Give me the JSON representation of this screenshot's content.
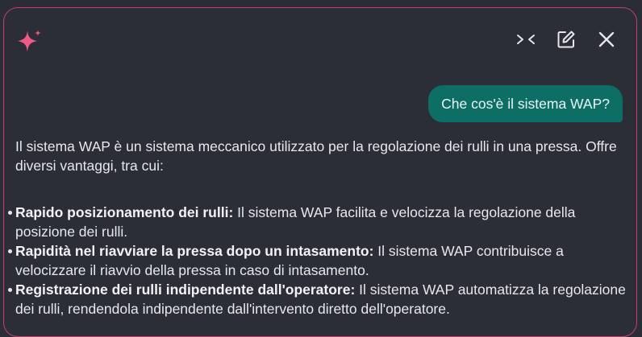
{
  "header": {
    "logo_icon": "sparkle-icon",
    "collapse_icon": "collapse-icon",
    "edit_icon": "edit-icon",
    "close_icon": "close-icon"
  },
  "colors": {
    "accent_border": "#c2406e",
    "sparkle": "#ef5b86",
    "user_bubble": "#0d6e66",
    "background": "#2b2e37"
  },
  "conversation": {
    "user_message": "Che cos'è il sistema WAP?",
    "answer_intro": "Il sistema WAP è un sistema meccanico utilizzato per la regolazione dei rulli in una pressa. Offre diversi vantaggi, tra cui:",
    "bullets": [
      {
        "title": "Rapido posizionamento dei rulli:",
        "text": " Il sistema WAP facilita e velocizza la regolazione della posizione dei rulli."
      },
      {
        "title": "Rapidità nel riavviare la pressa dopo un intasamento:",
        "text": " Il sistema WAP contribuisce a velocizzare il riavvio della pressa in caso di intasamento."
      },
      {
        "title": "Registrazione dei rulli indipendente dall'operatore:",
        "text": " Il sistema WAP automatizza la regolazione dei rulli, rendendola indipendente dall'intervento diretto dell'operatore."
      }
    ]
  }
}
